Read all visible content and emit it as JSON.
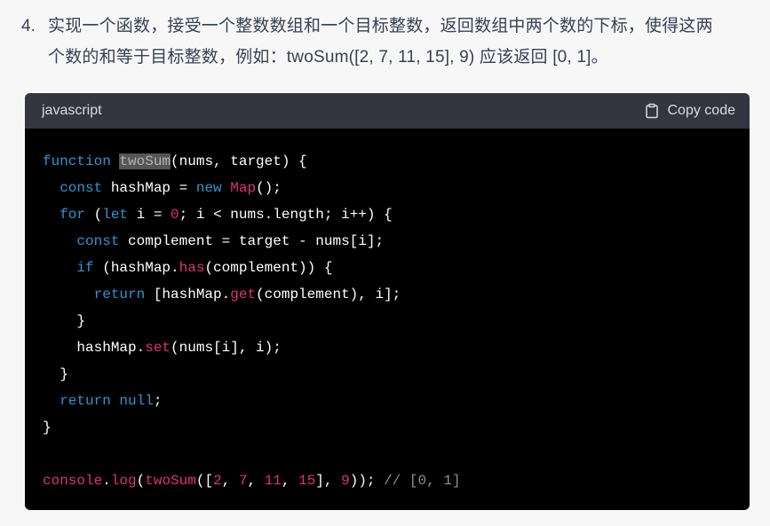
{
  "question": {
    "number": "4.",
    "line1": "实现一个函数，接受一个整数数组和一个目标整数，返回数组中两个数的下标，使得这两",
    "line2": "个数的和等于目标整数，例如：twoSum([2, 7, 11, 15], 9) 应该返回 [0, 1]。"
  },
  "code_block": {
    "language": "javascript",
    "copy_label": "Copy code",
    "copy_icon": "clipboard-icon",
    "lines": [
      [
        {
          "t": "function",
          "c": "kw"
        },
        {
          "t": " ",
          "c": "pl"
        },
        {
          "t": "twoSum",
          "c": "sel"
        },
        {
          "t": "(nums, target) {",
          "c": "pl"
        }
      ],
      [
        {
          "t": "  ",
          "c": "pl"
        },
        {
          "t": "const",
          "c": "kw"
        },
        {
          "t": " hashMap = ",
          "c": "pl"
        },
        {
          "t": "new",
          "c": "kw"
        },
        {
          "t": " ",
          "c": "pl"
        },
        {
          "t": "Map",
          "c": "fn"
        },
        {
          "t": "();",
          "c": "pl"
        }
      ],
      [
        {
          "t": "  ",
          "c": "pl"
        },
        {
          "t": "for",
          "c": "kw"
        },
        {
          "t": " (",
          "c": "pl"
        },
        {
          "t": "let",
          "c": "kw"
        },
        {
          "t": " i = ",
          "c": "pl"
        },
        {
          "t": "0",
          "c": "num"
        },
        {
          "t": "; i < nums.length; i++) {",
          "c": "pl"
        }
      ],
      [
        {
          "t": "    ",
          "c": "pl"
        },
        {
          "t": "const",
          "c": "kw"
        },
        {
          "t": " complement = target - nums[i];",
          "c": "pl"
        }
      ],
      [
        {
          "t": "    ",
          "c": "pl"
        },
        {
          "t": "if",
          "c": "kw"
        },
        {
          "t": " (hashMap.",
          "c": "pl"
        },
        {
          "t": "has",
          "c": "fn"
        },
        {
          "t": "(complement)) {",
          "c": "pl"
        }
      ],
      [
        {
          "t": "      ",
          "c": "pl"
        },
        {
          "t": "return",
          "c": "kw"
        },
        {
          "t": " [hashMap.",
          "c": "pl"
        },
        {
          "t": "get",
          "c": "fn"
        },
        {
          "t": "(complement), i];",
          "c": "pl"
        }
      ],
      [
        {
          "t": "    }",
          "c": "pl"
        }
      ],
      [
        {
          "t": "    hashMap.",
          "c": "pl"
        },
        {
          "t": "set",
          "c": "fn"
        },
        {
          "t": "(nums[i], i);",
          "c": "pl"
        }
      ],
      [
        {
          "t": "  }",
          "c": "pl"
        }
      ],
      [
        {
          "t": "  ",
          "c": "pl"
        },
        {
          "t": "return",
          "c": "kw"
        },
        {
          "t": " ",
          "c": "pl"
        },
        {
          "t": "null",
          "c": "kw"
        },
        {
          "t": ";",
          "c": "pl"
        }
      ],
      [
        {
          "t": "}",
          "c": "pl"
        }
      ],
      [],
      [
        {
          "t": "console",
          "c": "fn"
        },
        {
          "t": ".",
          "c": "pl"
        },
        {
          "t": "log",
          "c": "fn"
        },
        {
          "t": "(",
          "c": "pl"
        },
        {
          "t": "twoSum",
          "c": "fn"
        },
        {
          "t": "([",
          "c": "pl"
        },
        {
          "t": "2",
          "c": "num"
        },
        {
          "t": ", ",
          "c": "pl"
        },
        {
          "t": "7",
          "c": "num"
        },
        {
          "t": ", ",
          "c": "pl"
        },
        {
          "t": "11",
          "c": "num"
        },
        {
          "t": ", ",
          "c": "pl"
        },
        {
          "t": "15",
          "c": "num"
        },
        {
          "t": "], ",
          "c": "pl"
        },
        {
          "t": "9",
          "c": "num"
        },
        {
          "t": ")); ",
          "c": "pl"
        },
        {
          "t": "// [0, 1]",
          "c": "cm"
        }
      ]
    ]
  },
  "colors": {
    "page_bg": "#f7f7f8",
    "text": "#374151",
    "code_header_bg": "#343541",
    "code_bg": "#000000",
    "keyword": "#2e95d3",
    "function_number": "#df3079",
    "comment": "#8f8f8f",
    "selection_bg": "#555555"
  }
}
